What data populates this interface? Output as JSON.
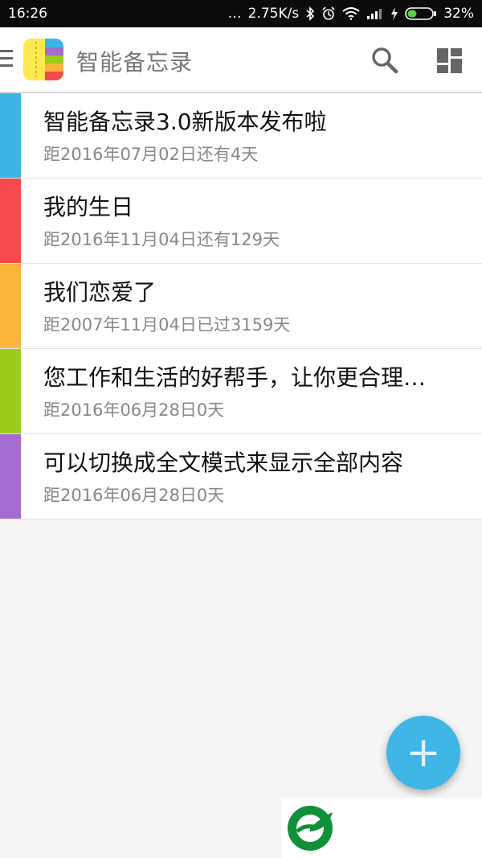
{
  "status_bar": {
    "time": "16:26",
    "dots": "…",
    "network_speed": "2.75K/s",
    "battery_percent": "32%",
    "icons": [
      "bluetooth-icon",
      "alarm-icon",
      "wifi-icon",
      "signal-icon",
      "charging-icon",
      "battery-icon"
    ]
  },
  "app_bar": {
    "title": "智能备忘录",
    "icons": [
      "menu-icon",
      "app-logo",
      "search-icon",
      "layout-grid-icon"
    ]
  },
  "memos": [
    {
      "title": "智能备忘录3.0新版本发布啦",
      "subtitle": "距2016年07月02日还有4天",
      "color": "#3ab4e4"
    },
    {
      "title": "我的生日",
      "subtitle": "距2016年11月04日还有129天",
      "color": "#f44a4d"
    },
    {
      "title": "我们恋爱了",
      "subtitle": "距2007年11月04日已过3159天",
      "color": "#fbb53a"
    },
    {
      "title": "您工作和生活的好帮手，让你更合理…",
      "subtitle": "距2016年06月28日0天",
      "color": "#9ccc1a"
    },
    {
      "title": "可以切换成全文模式来显示全部内容",
      "subtitle": "距2016年06月28日0天",
      "color": "#a46ccf"
    }
  ],
  "fab": {
    "label": "+",
    "color": "#3fb6e6"
  },
  "watermark": {
    "icon": "leaf-logo-icon"
  }
}
